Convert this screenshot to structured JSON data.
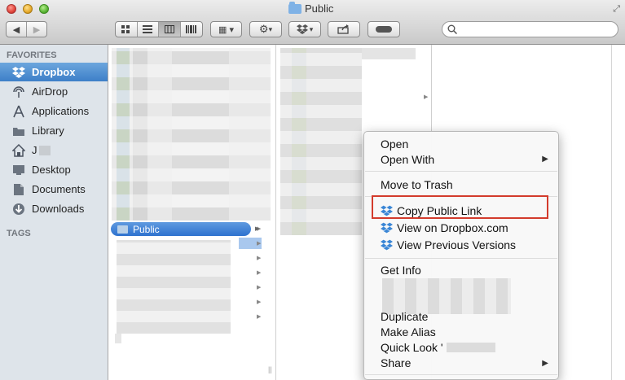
{
  "window": {
    "title": "Public"
  },
  "toolbar": {
    "view_buttons": [
      "icon-view-icon",
      "list-view-icon",
      "column-view-icon",
      "coverflow-view-icon"
    ],
    "arrange_icon": "arrange-icon",
    "action_icon": "gear-icon",
    "dropbox_icon": "dropbox-icon",
    "share_icon": "share-icon",
    "tag_icon": "tag-icon",
    "search_placeholder": ""
  },
  "sidebar": {
    "favorites_heading": "FAVORITES",
    "tags_heading": "TAGS",
    "items": [
      {
        "label": "Dropbox",
        "icon": "dropbox-icon",
        "selected": true
      },
      {
        "label": "AirDrop",
        "icon": "airdrop-icon",
        "selected": false
      },
      {
        "label": "Applications",
        "icon": "applications-icon",
        "selected": false
      },
      {
        "label": "Library",
        "icon": "folder-icon",
        "selected": false
      },
      {
        "label": "J",
        "icon": "home-icon",
        "selected": false
      },
      {
        "label": "Desktop",
        "icon": "desktop-icon",
        "selected": false
      },
      {
        "label": "Documents",
        "icon": "documents-icon",
        "selected": false
      },
      {
        "label": "Downloads",
        "icon": "downloads-icon",
        "selected": false
      }
    ]
  },
  "columns": {
    "selected_folder": "Public"
  },
  "context_menu": {
    "open": "Open",
    "open_with": "Open With",
    "move_to_trash": "Move to Trash",
    "copy_public_link": "Copy Public Link",
    "view_on_dropbox": "View on Dropbox.com",
    "view_previous_versions": "View Previous Versions",
    "get_info": "Get Info",
    "duplicate": "Duplicate",
    "make_alias": "Make Alias",
    "quick_look": "Quick Look '",
    "share": "Share"
  },
  "colors": {
    "highlight_box": "#d33b2c",
    "selection": "#3d7fc8",
    "sidebar_bg": "#dee4ea"
  }
}
